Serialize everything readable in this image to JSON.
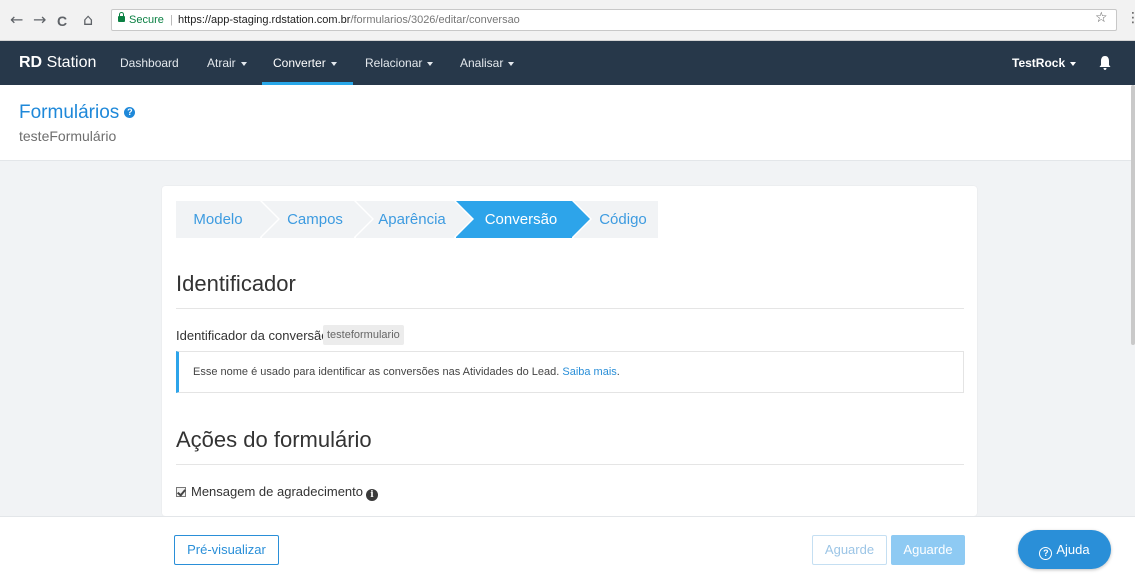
{
  "browser": {
    "back": "←",
    "forward": "→",
    "reload": "C",
    "home": "⌂",
    "secure_label": "Secure",
    "url_host": "https://app-staging.rdstation.com.br",
    "url_path": "/formularios/3026/editar/conversao",
    "star": "☆",
    "menu": "⋮"
  },
  "navbar": {
    "logo_bold": "RD",
    "logo_rest": "Station",
    "items": [
      {
        "label": "Dashboard"
      },
      {
        "label": "Atrair"
      },
      {
        "label": "Converter"
      },
      {
        "label": "Relacionar"
      },
      {
        "label": "Analisar"
      }
    ],
    "active_item": "Converter",
    "user": "TestRock",
    "colors": {
      "background": "#27384a",
      "accent": "#28a7e9"
    }
  },
  "header": {
    "title": "Formulários",
    "help": "?",
    "subtitle": "testeFormulário"
  },
  "steps": [
    {
      "label": "Modelo"
    },
    {
      "label": "Campos"
    },
    {
      "label": "Aparência"
    },
    {
      "label": "Conversão"
    },
    {
      "label": "Código"
    }
  ],
  "active_step": "Conversão",
  "identificador": {
    "title": "Identificador",
    "label": "Identificador da conversão:",
    "value": "testeformulario",
    "info_text": "Esse nome é usado para identificar as conversões nas Atividades do Lead.",
    "info_link": "Saiba mais",
    "info_after_link": "."
  },
  "acoes": {
    "title": "Ações do formulário",
    "checkbox_label": "Mensagem de agradecimento",
    "checkbox_checked": true,
    "info_icon": "i"
  },
  "footer": {
    "preview_label": "Pré-visualizar",
    "wait1_label": "Aguarde",
    "wait2_label": "Aguarde",
    "help_label": "Ajuda",
    "help_icon": "?"
  }
}
